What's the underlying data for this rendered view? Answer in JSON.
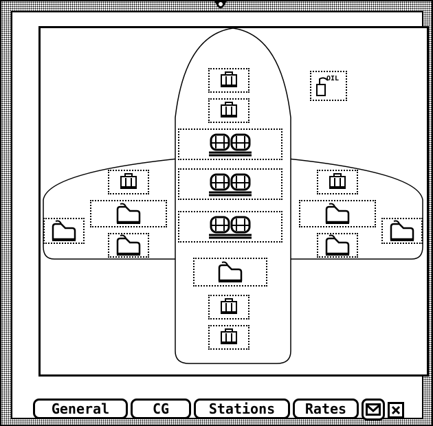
{
  "diagram": {
    "oil_label": "OIL",
    "stations": [
      {
        "kind": "bag",
        "icon": "bag-icon",
        "area": "fuselage"
      },
      {
        "kind": "bag",
        "icon": "bag-icon",
        "area": "fuselage"
      },
      {
        "kind": "seats",
        "icon": "seat-pair-icon",
        "area": "fuselage"
      },
      {
        "kind": "seats",
        "icon": "seat-pair-icon",
        "area": "fuselage"
      },
      {
        "kind": "seats",
        "icon": "seat-pair-icon",
        "area": "fuselage"
      },
      {
        "kind": "fuel",
        "icon": "fuel-tank-icon",
        "area": "aft-fuselage"
      },
      {
        "kind": "bag",
        "icon": "bag-icon",
        "area": "tail"
      },
      {
        "kind": "bag",
        "icon": "bag-icon",
        "area": "tail"
      },
      {
        "kind": "bag",
        "icon": "bag-icon",
        "area": "left-wing"
      },
      {
        "kind": "fuel",
        "icon": "fuel-tank-icon",
        "area": "left-wing"
      },
      {
        "kind": "fuel",
        "icon": "fuel-tank-icon",
        "area": "left-wing"
      },
      {
        "kind": "fuel",
        "icon": "fuel-tank-icon",
        "area": "left-wing-tip"
      },
      {
        "kind": "bag",
        "icon": "bag-icon",
        "area": "right-wing"
      },
      {
        "kind": "fuel",
        "icon": "fuel-tank-icon",
        "area": "right-wing"
      },
      {
        "kind": "fuel",
        "icon": "fuel-tank-icon",
        "area": "right-wing"
      },
      {
        "kind": "fuel",
        "icon": "fuel-tank-icon",
        "area": "right-wing-tip"
      },
      {
        "kind": "oil",
        "icon": "oil-can-icon",
        "area": "engine"
      }
    ]
  },
  "tabs": {
    "general": "General",
    "cg": "CG",
    "stations": "Stations",
    "rates": "Rates"
  },
  "buttons": {
    "mail_icon": "envelope-icon",
    "close_icon": "close-icon"
  }
}
